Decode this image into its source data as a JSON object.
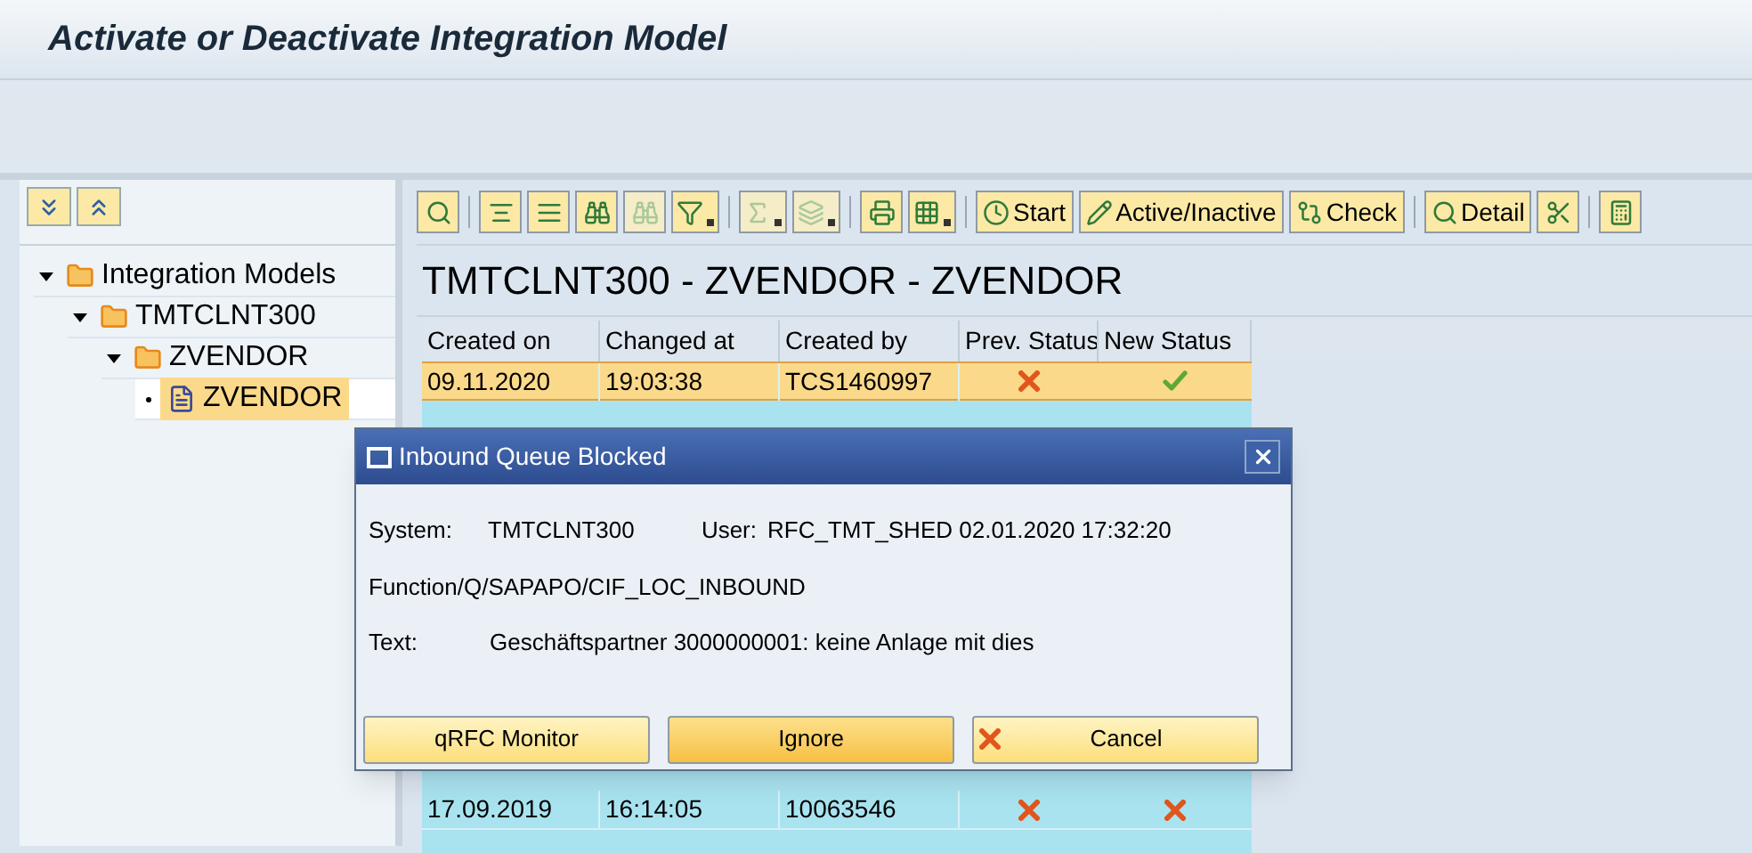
{
  "window": {
    "title": "Activate or Deactivate Integration Model"
  },
  "tree_buttons": [
    {
      "kind": "expand"
    },
    {
      "kind": "collapse"
    }
  ],
  "tree": [
    {
      "label": "Integration Models",
      "kind": "folder",
      "expanded": true,
      "selected": false,
      "children": [
        {
          "label": "TMTCLNT300",
          "kind": "folder",
          "expanded": true,
          "selected": false,
          "children": [
            {
              "label": "ZVENDOR",
              "kind": "folder",
              "expanded": true,
              "selected": false,
              "children": [
                {
                  "label": "ZVENDOR",
                  "kind": "document",
                  "selected": true
                }
              ]
            }
          ]
        }
      ]
    }
  ],
  "toolbar": [
    {
      "kind": "icon",
      "disabled": false
    },
    {
      "kind": "separator"
    },
    {
      "kind": "icon",
      "disabled": false
    },
    {
      "kind": "icon",
      "disabled": false
    },
    {
      "kind": "icon",
      "disabled": false
    },
    {
      "kind": "icon",
      "disabled": true
    },
    {
      "kind": "menu",
      "disabled": false
    },
    {
      "kind": "separator"
    },
    {
      "kind": "menu",
      "disabled": true
    },
    {
      "kind": "menu",
      "disabled": true
    },
    {
      "kind": "separator"
    },
    {
      "kind": "icon",
      "disabled": false
    },
    {
      "kind": "menu",
      "disabled": false
    },
    {
      "kind": "separator"
    },
    {
      "kind": "text",
      "label": "Start"
    },
    {
      "kind": "text",
      "label": "Active/Inactive"
    },
    {
      "kind": "text",
      "label": "Check"
    },
    {
      "kind": "separator"
    },
    {
      "kind": "text",
      "label": "Detail"
    },
    {
      "kind": "icon",
      "disabled": false
    },
    {
      "kind": "separator"
    },
    {
      "kind": "icon",
      "disabled": false
    }
  ],
  "heading": "TMTCLNT300 - ZVENDOR - ZVENDOR",
  "table": {
    "columns": [
      "Created on",
      "Changed at",
      "Created by",
      "Prev. Status",
      "New Status"
    ],
    "rows": [
      {
        "selected": true,
        "created_on": "09.11.2020",
        "changed_at": "19:03:38",
        "created_by": "TCS1460997",
        "prev_ok": false,
        "new_ok": true
      },
      {
        "selected": false,
        "created_on": "17.09.2019",
        "changed_at": "16:14:05",
        "created_by": "10063546",
        "prev_ok": false,
        "new_ok": false
      }
    ]
  },
  "dialog": {
    "title": "Inbound Queue Blocked",
    "system_label": "System:",
    "system": "TMTCLNT300",
    "user_label": "User:",
    "user": "RFC_TMT_SHED 02.01.2020 17:32:20",
    "function": "Function/Q/SAPAPO/CIF_LOC_INBOUND",
    "text_label": "Text:",
    "text": "Geschäftspartner 3000000001: keine Anlage mit dies",
    "buttons": [
      {
        "label": "qRFC Monitor",
        "selected": false
      },
      {
        "label": "Ignore",
        "selected": true
      },
      {
        "label": "Cancel",
        "selected": false
      }
    ]
  }
}
